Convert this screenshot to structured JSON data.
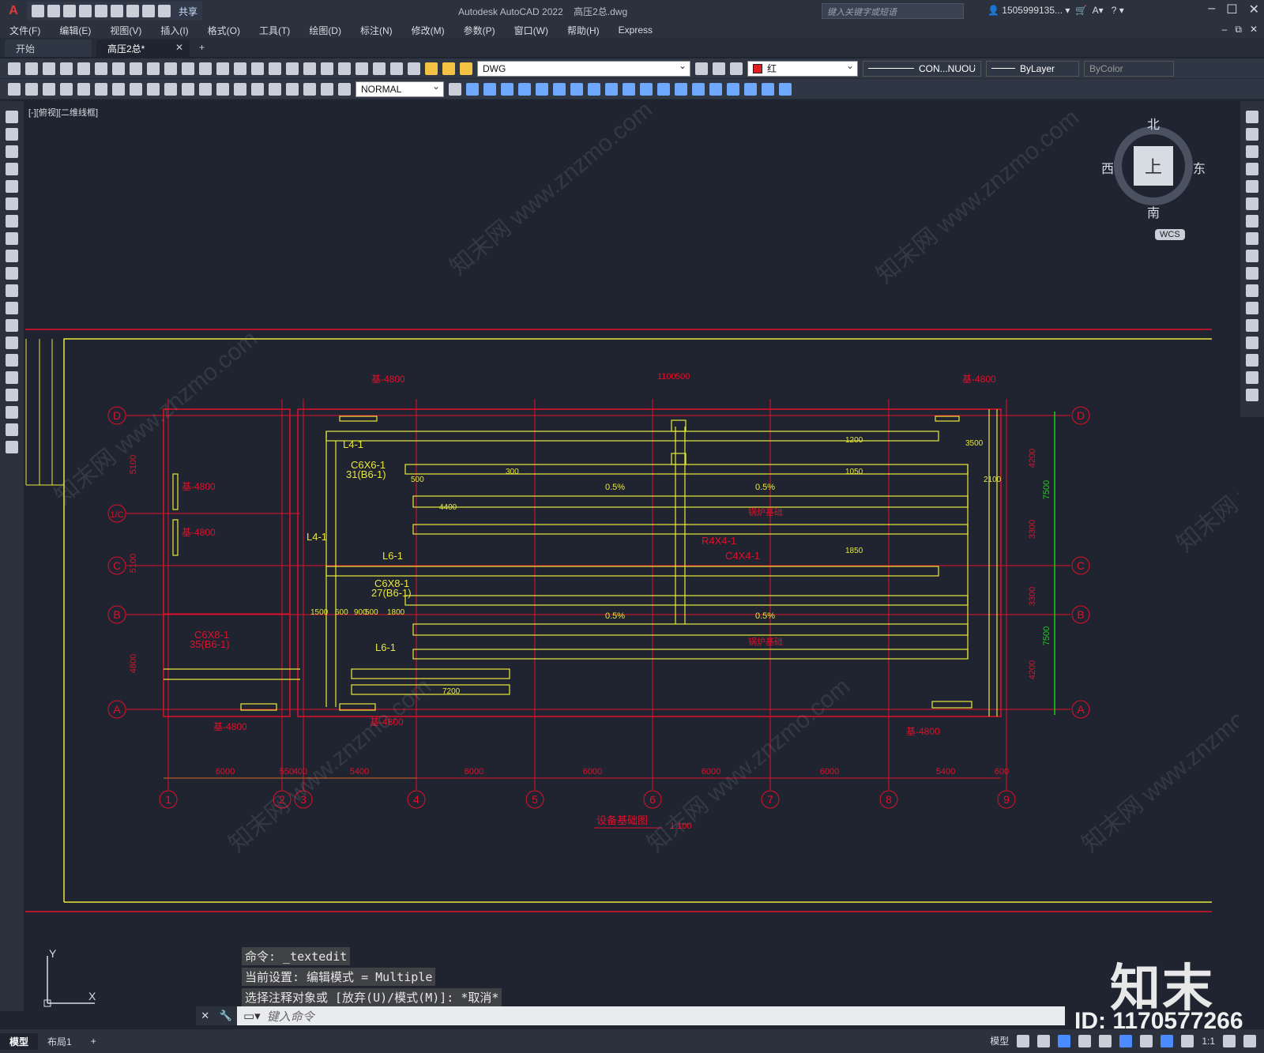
{
  "app": {
    "title": "Autodesk AutoCAD 2022",
    "file": "高压2总.dwg",
    "share": "共享",
    "search_placeholder": "键入关键字或短语",
    "user": "1505999135..."
  },
  "menu": [
    "文件(F)",
    "编辑(E)",
    "视图(V)",
    "插入(I)",
    "格式(O)",
    "工具(T)",
    "绘图(D)",
    "标注(N)",
    "修改(M)",
    "参数(P)",
    "窗口(W)",
    "帮助(H)",
    "Express"
  ],
  "tabs": {
    "start": "开始",
    "active": "高压2总*"
  },
  "toolbar": {
    "layer_name": "DWG",
    "color": "红",
    "linetype": "CON...NUOU",
    "lineweight": "ByLayer",
    "plotstyle": "ByColor",
    "text_style": "NORMAL"
  },
  "viewport": {
    "label": "[-][俯视][二维线框]"
  },
  "navcube": {
    "north": "北",
    "south": "南",
    "east": "东",
    "west": "西",
    "top": "上",
    "wcs": "WCS"
  },
  "drawing": {
    "grid_rows": [
      "D",
      "C",
      "B",
      "A"
    ],
    "grid_row_extra": "1/C",
    "grid_cols": [
      "1",
      "2",
      "3",
      "4",
      "5",
      "6",
      "7",
      "8",
      "9"
    ],
    "bottom_dims": [
      "6000",
      "550",
      "400",
      "5400",
      "6000",
      "6000",
      "6000",
      "6000",
      "5400",
      "600"
    ],
    "left_dims": [
      "5100",
      "5100",
      "4800"
    ],
    "right_dims": [
      "4200",
      "3300",
      "3300",
      "4200"
    ],
    "right_dims_big": [
      "7500",
      "7500"
    ],
    "top_dims": [
      "1100",
      "500"
    ],
    "beam_labels": [
      "L4-1",
      "C6X6-1",
      "31(B6-1)",
      "L4-1",
      "L6-1",
      "C6X8-1",
      "27(B6-1)",
      "L6-1",
      "C6X8-1",
      "35(B6-1)",
      "R4X4-1",
      "C4X4-1"
    ],
    "boiler_label": "锅炉基础",
    "slope": "0.5%",
    "level_tag": "基-4800",
    "title": "设备基础图",
    "scale": "1:100",
    "dims_misc": [
      "4400",
      "7200",
      "1500",
      "600",
      "900",
      "500",
      "1800",
      "3500",
      "2100",
      "1050",
      "1200",
      "1850",
      "300",
      "500"
    ]
  },
  "command": {
    "history": [
      "命令: _textedit",
      "当前设置: 编辑模式 = Multiple",
      "选择注释对象或 [放弃(U)/模式(M)]: *取消*"
    ],
    "prompt": "键入命令"
  },
  "layout_tabs": [
    "模型",
    "布局1"
  ],
  "status": {
    "model": "模型",
    "scale": "1:1"
  },
  "watermark": {
    "brand": "知末",
    "id": "ID: 1170577266",
    "site": "知末网 www.znzmo.com"
  },
  "colors": {
    "canvas": "#1f2430",
    "red": "#e0102a",
    "yellow": "#e8e83a",
    "green": "#19d019"
  }
}
